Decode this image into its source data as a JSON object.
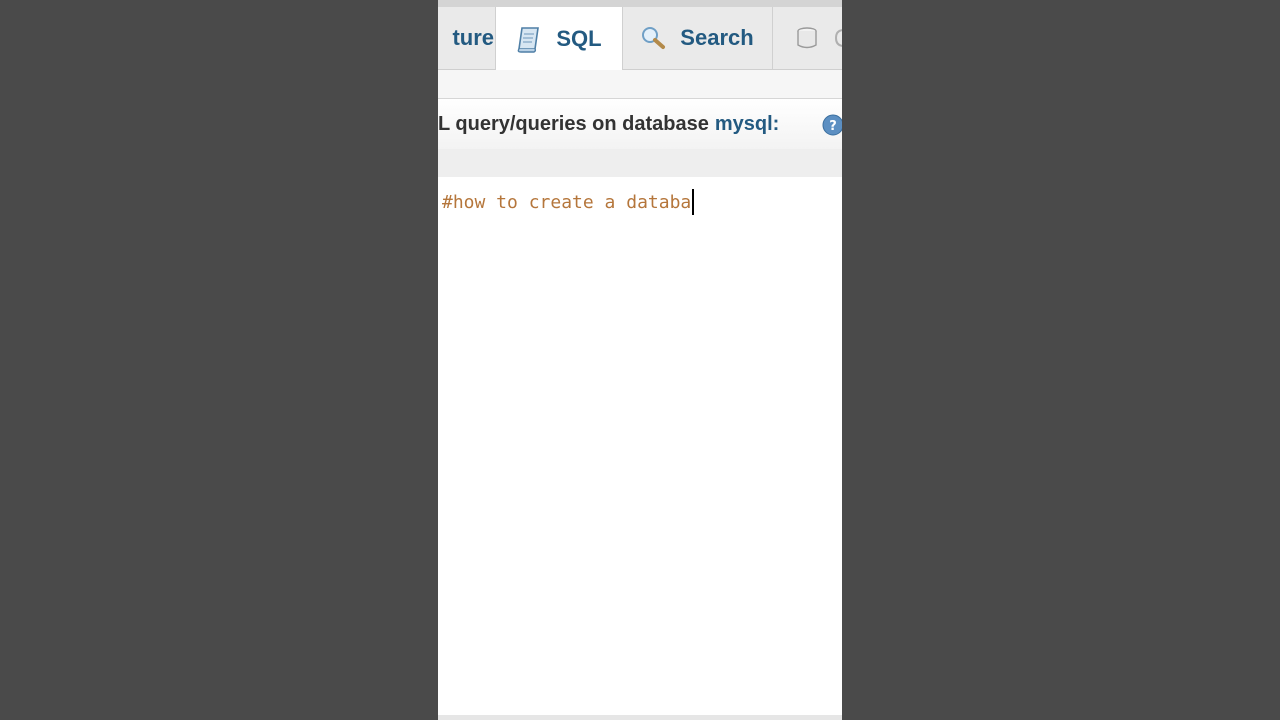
{
  "tabs": {
    "structure": "ture",
    "sql": "SQL",
    "search": "Search"
  },
  "heading": {
    "prefix": "L query/queries on database",
    "database": "mysql:"
  },
  "editor": {
    "text": "#how to create a databa"
  },
  "colors": {
    "link": "#235a81",
    "comment": "#b5763b",
    "backdrop": "#4a4a4a"
  },
  "icons": [
    "sql-scroll-icon",
    "search-magnifier-icon",
    "database-icon",
    "help-icon"
  ]
}
